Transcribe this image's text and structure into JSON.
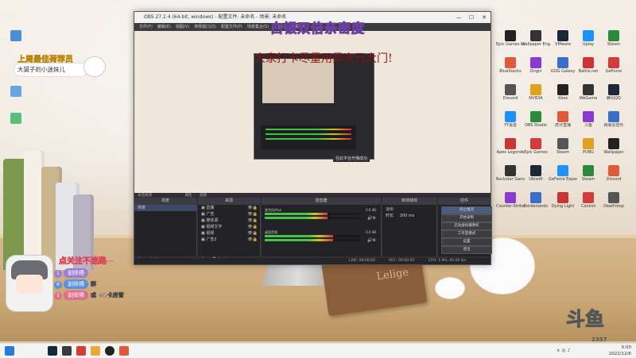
{
  "stream_overlay": {
    "headline_top": "白银双倍亲密度",
    "headline_main": "大家打卡尽量用异次元大门!",
    "best_member_title": "上周最佳荷荐员",
    "best_member_name": "大舅子的小迷妹儿",
    "follow_prompt": "点关注不迷路~",
    "leaderboard": [
      {
        "rank": "1",
        "name": "驯师傅",
        "color": "#9b7fd6",
        "suffix": ""
      },
      {
        "rank": "6",
        "name": "驯师傅",
        "color": "#5b8fe0",
        "suffix": "群"
      },
      {
        "rank": "1",
        "name": "驯师傅",
        "color": "#e06d8a",
        "suffix": "或",
        "extra": "+2卡房管"
      }
    ],
    "platform_watermark": "斗鱼",
    "room_id": "2357"
  },
  "notebook_label": "Lelige",
  "obs": {
    "title": "OBS 27.2.4 (64-bit, windows) - 配置文件: 未命名 - 场景: 未命名",
    "menu": [
      "文件(F)",
      "编辑(E)",
      "视图(V)",
      "停靠窗口(D)",
      "配置文件(P)",
      "场景集合(S)",
      "工具(T)",
      "帮助(H)"
    ],
    "preview_tag": "在此平台开播成功",
    "source_bar": {
      "no_source": "未选择源",
      "properties": "属性",
      "filters": "滤镜"
    },
    "docks": {
      "scenes": {
        "title": "场景",
        "items": [
          "场景"
        ]
      },
      "sources": {
        "title": "来源",
        "items": [
          "直播",
          "广告",
          "媒体源",
          "视频文字",
          "视频",
          "广告2"
        ]
      },
      "mixer": {
        "title": "混音器",
        "channels": [
          {
            "name": "麦克风/Aux",
            "level": "0.0 dB",
            "fill": 0.66
          },
          {
            "name": "桌面音频",
            "level": "0.0 dB",
            "fill": 0.72
          }
        ]
      },
      "transitions": {
        "title": "转场特效",
        "mode": "淡出",
        "duration_label": "时长",
        "duration": "300 ms"
      },
      "controls": {
        "title": "控件",
        "buttons": [
          "停止推流",
          "开始录制",
          "启动虚拟摄像机",
          "工作室模式",
          "设置",
          "退出"
        ]
      }
    },
    "status": {
      "live": "LIVE: 00:00:00",
      "rec": "REC: 00:00:00",
      "cpu": "CPU: 1.9%, 60.00 fps"
    }
  },
  "desktop_icons": [
    "Epic Games Launcher",
    "Wallpaper Engine",
    "VMware",
    "Uplay",
    "Steam",
    "BlueStacks",
    "Origin",
    "GOG Galaxy",
    "Battle.net",
    "GeForce",
    "Discord",
    "NVIDIA",
    "Xbox",
    "WeGame",
    "腾讯QQ",
    "YY语音",
    "OBS Studio",
    "虎牙直播",
    "斗鱼",
    "网易云音乐",
    "Apex Legends",
    "Epic Games",
    "Steam",
    "PUBG",
    "Wallpaper",
    "Rockstar Games",
    "Ubisoft",
    "GeForce Experience",
    "Steam",
    "Discord",
    "Counter-Strike",
    "Borderlands",
    "Dying Light",
    "Control",
    "Deathloop"
  ],
  "taskbar": {
    "time": "2022/12/6",
    "clock": "0:00"
  }
}
